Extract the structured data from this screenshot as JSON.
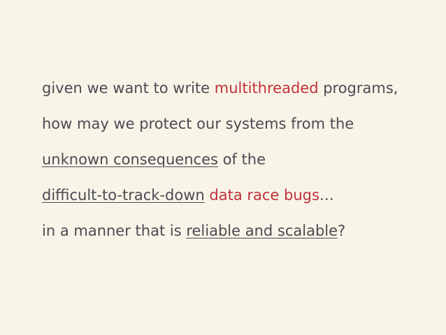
{
  "lines": [
    {
      "segments": [
        "given we want to write ",
        "multithreaded",
        " programs,"
      ]
    },
    {
      "segments": [
        "how may we protect our systems from the"
      ]
    },
    {
      "segments": [
        "unknown consequences",
        " of the"
      ]
    },
    {
      "segments": [
        "difficult-to-track-down",
        " ",
        "data race bugs",
        "…"
      ]
    },
    {
      "segments": [
        "in a manner that is ",
        "reliable and scalable",
        "?"
      ]
    }
  ],
  "colors": {
    "background": "#f8f4e8",
    "text": "#4a4a52",
    "highlight": "#c0303a"
  }
}
